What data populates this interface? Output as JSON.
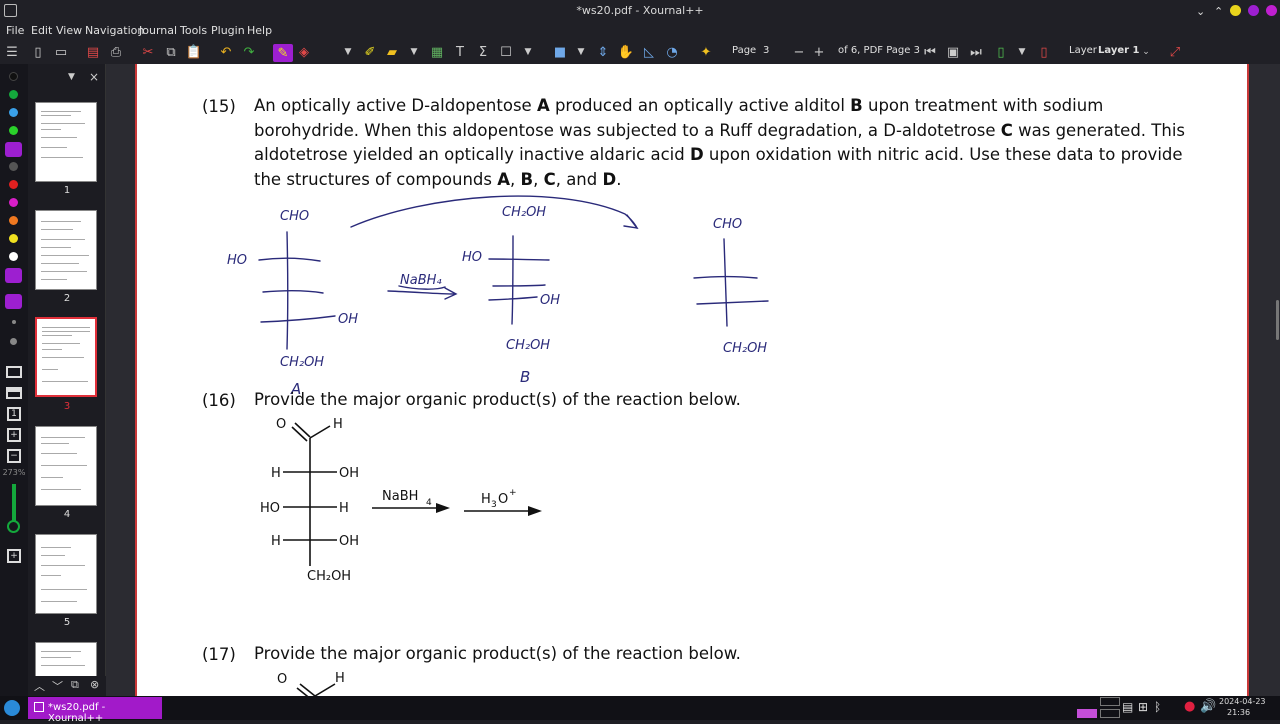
{
  "window": {
    "title": "*ws20.pdf - Xournal++"
  },
  "menu": [
    "File",
    "Edit",
    "View",
    "Navigation",
    "Journal",
    "Tools",
    "Plugin",
    "Help"
  ],
  "toolbar": {
    "page_label": "Page",
    "page_value": "3",
    "page_of": "of 6, PDF Page 3",
    "layer_label": "Layer",
    "layer_value": "Layer 1"
  },
  "sidebar": {
    "pages": [
      "1",
      "2",
      "3",
      "4",
      "5"
    ],
    "selected": "3",
    "zoom_readout": "273%"
  },
  "colors": {
    "accent": "#9d1fd0",
    "selection": "#e0303a",
    "ink": "#2a2a7a",
    "palette": [
      "#111111",
      "#14a83c",
      "#3aa0e8",
      "#2ad12a",
      "#9d1fd0",
      "#555555",
      "#e02020",
      "#d81ec8",
      "#f07820",
      "#f0e020",
      "#ffffff",
      "#9d1fd0",
      "#9d1fd0"
    ]
  },
  "document": {
    "q15": {
      "number": "(15)",
      "line1_a": "An optically active D-aldopentose ",
      "A": "A",
      "line1_b": " produced an optically active alditol ",
      "B": "B",
      "line1_c": " upon treatment with sodium",
      "line2_a": "borohydride. When this aldopentose was subjected to a Ruff degradation, a D-aldotetrose ",
      "C": "C",
      "line2_b": " was generated. This",
      "line3_a": "aldotetrose yielded an optically inactive aldaric acid ",
      "D": "D",
      "line3_b": " upon oxidation with nitric acid. Use these data to provide",
      "line4_a": "the structures of compounds ",
      "comma1": ", ",
      "comma2": ", ",
      "and": ", and ",
      "period": "."
    },
    "handwriting": {
      "a_top": "CHO",
      "a_ho": "HO",
      "a_oh": "OH",
      "a_bottom": "CH₂OH",
      "a_label": "A",
      "reagent": "NaBH₄",
      "b_top": "CH₂OH",
      "b_ho": "HO",
      "b_oh": "OH",
      "b_bottom": "CH₂OH",
      "b_label": "B",
      "c_top": "CHO",
      "c_bottom": "CH₂OH"
    },
    "q16": {
      "number": "(16)",
      "text": "Provide the major organic product(s) of the reaction below.",
      "o": "O",
      "h_ald": "H",
      "r1_left": "H",
      "r1_right": "OH",
      "r2_left": "HO",
      "r2_right": "H",
      "r3_left": "H",
      "r3_right": "OH",
      "bottom": "CH₂OH",
      "reagent1": "NaBH",
      "reagent1_sub": "4",
      "reagent2": "H",
      "reagent2_sub": "3",
      "reagent2_o": "O",
      "reagent2_sup": "+"
    },
    "q17": {
      "number": "(17)",
      "text": "Provide the major organic product(s) of the reaction below.",
      "o": "O",
      "h_ald": "H"
    }
  },
  "taskbar": {
    "task": "*ws20.pdf - Xournal++",
    "date": "2024-04-23",
    "time": "21:36"
  }
}
